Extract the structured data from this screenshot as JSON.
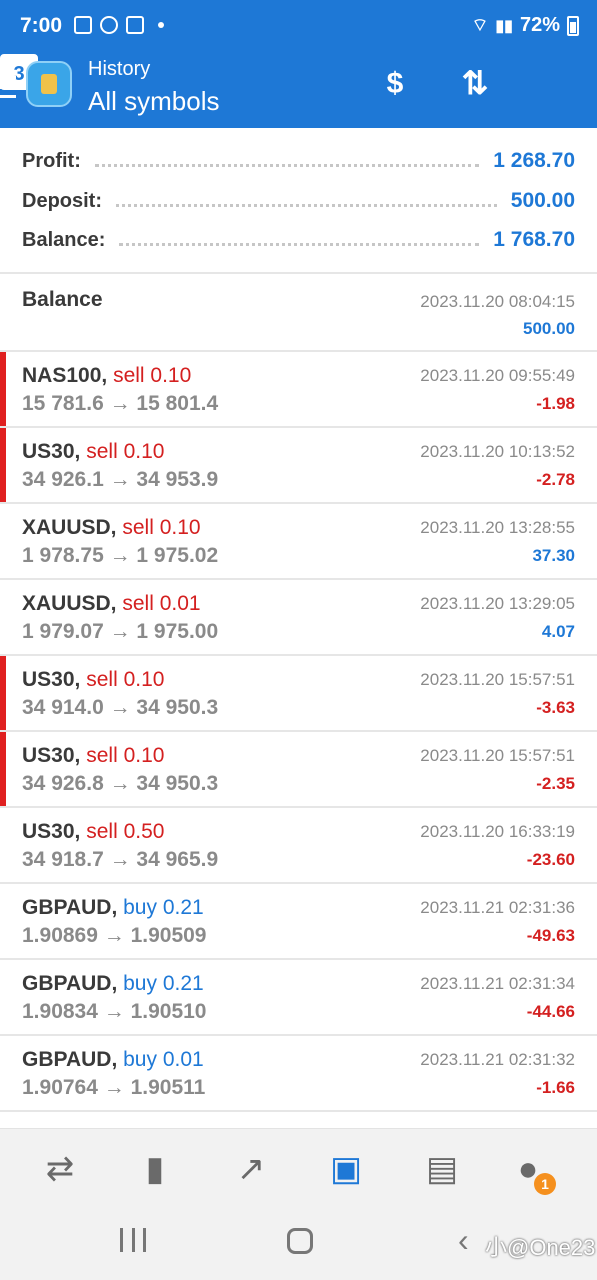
{
  "status_bar": {
    "time": "7:00",
    "battery": "72%"
  },
  "app_bar": {
    "subtitle": "History",
    "title": "All symbols",
    "calendar_value": "3"
  },
  "summary": {
    "profit_label": "Profit:",
    "profit_value": "1 268.70",
    "deposit_label": "Deposit:",
    "deposit_value": "500.00",
    "balance_label": "Balance:",
    "balance_value": "1 768.70"
  },
  "balance_entry": {
    "label": "Balance",
    "datetime": "2023.11.20 08:04:15",
    "amount": "500.00"
  },
  "deals": [
    {
      "symbol": "NAS100,",
      "side": "sell 0.10",
      "prices": "15 781.6 → 15 801.4",
      "datetime": "2023.11.20 09:55:49",
      "pl": "-1.98"
    },
    {
      "symbol": "US30,",
      "side": "sell 0.10",
      "prices": "34 926.1 → 34 953.9",
      "datetime": "2023.11.20 10:13:52",
      "pl": "-2.78"
    },
    {
      "symbol": "XAUUSD,",
      "side": "sell 0.10",
      "prices": "1 978.75 → 1 975.02",
      "datetime": "2023.11.20 13:28:55",
      "pl": "37.30"
    },
    {
      "symbol": "XAUUSD,",
      "side": "sell 0.01",
      "prices": "1 979.07 → 1 975.00",
      "datetime": "2023.11.20 13:29:05",
      "pl": "4.07"
    },
    {
      "symbol": "US30,",
      "side": "sell 0.10",
      "prices": "34 914.0 → 34 950.3",
      "datetime": "2023.11.20 15:57:51",
      "pl": "-3.63"
    },
    {
      "symbol": "US30,",
      "side": "sell 0.10",
      "prices": "34 926.8 → 34 950.3",
      "datetime": "2023.11.20 15:57:51",
      "pl": "-2.35"
    },
    {
      "symbol": "US30,",
      "side": "sell 0.50",
      "prices": "34 918.7 → 34 965.9",
      "datetime": "2023.11.20 16:33:19",
      "pl": "-23.60"
    },
    {
      "symbol": "GBPAUD,",
      "side": "buy 0.21",
      "prices": "1.90869 → 1.90509",
      "datetime": "2023.11.21 02:31:36",
      "pl": "-49.63"
    },
    {
      "symbol": "GBPAUD,",
      "side": "buy 0.21",
      "prices": "1.90834 → 1.90510",
      "datetime": "2023.11.21 02:31:34",
      "pl": "-44.66"
    },
    {
      "symbol": "GBPAUD,",
      "side": "buy 0.01",
      "prices": "1.90764 → 1.90511",
      "datetime": "2023.11.21 02:31:32",
      "pl": "-1.66"
    }
  ],
  "tabs": [
    {
      "name": "quotes-tab",
      "icon": "arrows-icon"
    },
    {
      "name": "chart-tab",
      "icon": "candles-icon"
    },
    {
      "name": "trade-tab",
      "icon": "trend-icon"
    },
    {
      "name": "history-tab",
      "icon": "inbox-icon"
    },
    {
      "name": "news-tab",
      "icon": "newspaper-icon"
    },
    {
      "name": "messages-tab",
      "icon": "chat-icon"
    }
  ],
  "chat_badge": "1",
  "watermark": "小@One23",
  "colors": {
    "primary": "#1e78d6",
    "loss": "#d42020",
    "badge": "#f5901e"
  }
}
